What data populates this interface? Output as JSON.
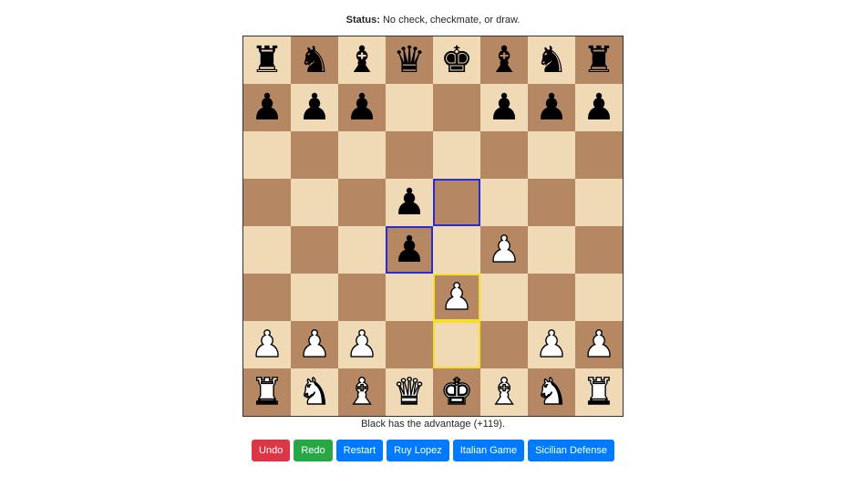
{
  "status": {
    "label": "Status:",
    "text": "No check, checkmate, or draw."
  },
  "board": {
    "rows": [
      [
        "br",
        "bn",
        "bb",
        "bq",
        "bk",
        "bb",
        "bn",
        "br"
      ],
      [
        "bp",
        "bp",
        "bp",
        "",
        "",
        "bp",
        "bp",
        "bp"
      ],
      [
        "",
        "",
        "",
        "",
        "",
        "",
        "",
        ""
      ],
      [
        "",
        "",
        "",
        "bp",
        "",
        "",
        "",
        ""
      ],
      [
        "",
        "",
        "",
        "bp",
        "",
        "wp",
        "",
        ""
      ],
      [
        "",
        "",
        "",
        "",
        "wp",
        "",
        "",
        ""
      ],
      [
        "wp",
        "wp",
        "wp",
        "",
        "",
        "",
        "wp",
        "wp"
      ],
      [
        "wr",
        "wn",
        "wb",
        "wq",
        "wk",
        "wb",
        "wn",
        "wr"
      ]
    ],
    "highlights": {
      "3-4": "blue",
      "4-3": "blue",
      "5-4": "yellow",
      "6-4": "yellow"
    },
    "piece_glyphs": {
      "k": "♚",
      "q": "♛",
      "r": "♜",
      "b": "♝",
      "n": "♞",
      "p": "♟"
    },
    "piece_names": {
      "k": "king",
      "q": "queen",
      "r": "rook",
      "b": "bishop",
      "n": "knight",
      "p": "pawn"
    },
    "colors": {
      "light": "#f0d9b5",
      "dark": "#b58863",
      "highlight_blue": "#2a2ad6",
      "highlight_yellow": "#f2e02a"
    }
  },
  "evaluation": {
    "text": "Black has the advantage (+119)."
  },
  "buttons": {
    "undo": "Undo",
    "redo": "Redo",
    "restart": "Restart",
    "ruy_lopez": "Ruy Lopez",
    "italian_game": "Italian Game",
    "sicilian_defense": "Sicilian Defense"
  }
}
